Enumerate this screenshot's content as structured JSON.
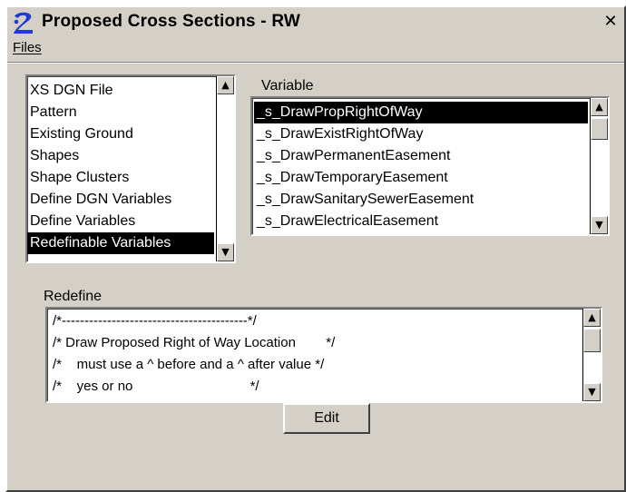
{
  "window": {
    "title": "Proposed Cross Sections - RW",
    "close_label": "✕"
  },
  "menu": {
    "files_label": "Files"
  },
  "categories": {
    "items": [
      "XS DGN File",
      "Pattern",
      "Existing Ground",
      "Shapes",
      "Shape Clusters",
      "Define DGN Variables",
      "Define Variables",
      "Redefinable Variables"
    ],
    "selected": "Redefinable Variables"
  },
  "variable": {
    "label": "Variable",
    "items": [
      "_s_DrawPropRightOfWay",
      "_s_DrawExistRightOfWay",
      "_s_DrawPermanentEasement",
      "_s_DrawTemporaryEasement",
      "_s_DrawSanitarySewerEasement",
      "_s_DrawElectricalEasement"
    ],
    "selected": "_s_DrawPropRightOfWay"
  },
  "redefine": {
    "label": "Redefine",
    "lines": [
      "/*-----------------------------------------*/",
      "/* Draw Proposed Right of Way Location        */",
      "/*    must use a ^ before and a ^ after value */",
      "/*    yes or no                               */"
    ]
  },
  "buttons": {
    "edit_label": "Edit"
  },
  "colors": {
    "window_bg": "#d4d0c8",
    "selection_bg": "#000000",
    "selection_fg": "#ffffff",
    "icon_blue": "#1f3bd4"
  }
}
